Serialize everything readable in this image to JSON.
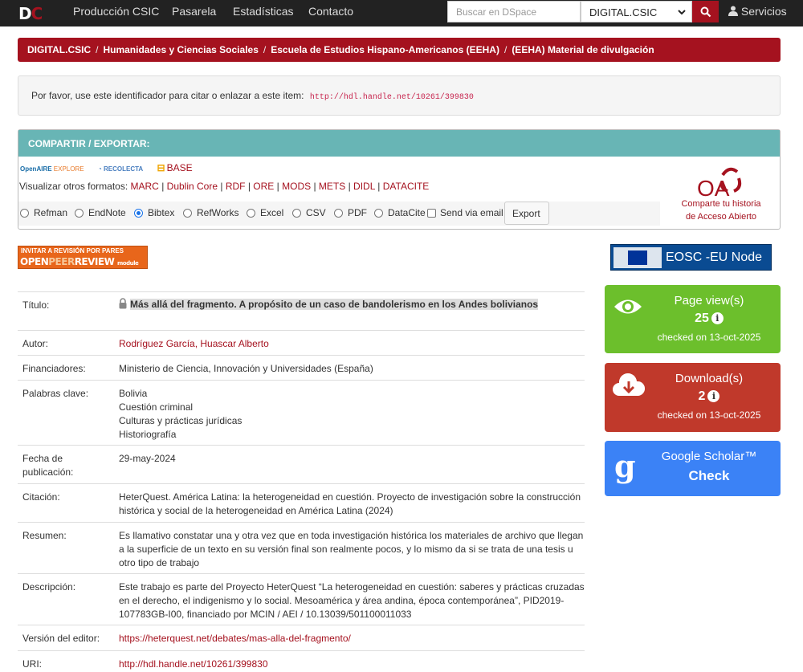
{
  "navbar": {
    "logo_d": "D",
    "logo_c": "C",
    "links": [
      "Producción CSIC",
      "Pasarela",
      "Estadísticas",
      "Contacto"
    ],
    "search_placeholder": "Buscar en DSpace",
    "scope": "DIGITAL.CSIC",
    "servicios": "Servicios"
  },
  "breadcrumb": [
    "DIGITAL.CSIC",
    "Humanidades y Ciencias Sociales",
    "Escuela de Estudios Hispano-Americanos (EEHA)",
    "(EEHA) Material de divulgación"
  ],
  "handle": {
    "text": "Por favor, use este identificador para citar o enlazar a este item:",
    "url": "http://hdl.handle.net/10261/399830"
  },
  "share": {
    "heading": "COMPARTIR / EXPORTAR:",
    "openaire": "OpenAIRE",
    "openaire_sub": "EXPLORE",
    "recolecta": "RECOLECTA",
    "base": "BASE",
    "formats_label": "Visualizar otros formatos:",
    "formats": [
      "MARC",
      "Dublin Core",
      "RDF",
      "ORE",
      "MODS",
      "METS",
      "DIDL",
      "DATACITE"
    ],
    "export_options": [
      "Refman",
      "EndNote",
      "Bibtex",
      "RefWorks",
      "Excel",
      "CSV",
      "PDF",
      "DataCite"
    ],
    "selected": "Bibtex",
    "send_email": "Send via email",
    "export_button": "Export",
    "oa_line1": "Comparte tu historia",
    "oa_line2": "de Acceso Abierto"
  },
  "opr": {
    "line1": "INVITAR A REVISIÓN POR PARES",
    "open": "OPEN",
    "peer": "PEER",
    "review": "REVIEW",
    "module": "module"
  },
  "eosc": "EOSC -EU Node",
  "metadata": {
    "titulo_label": "Título:",
    "titulo": "Más allá del fragmento. A propósito de un caso de bandolerismo en los Andes bolivianos",
    "autor_label": "Autor:",
    "autor": "Rodríguez García, Huascar Alberto",
    "financiadores_label": "Financiadores:",
    "financiadores": "Ministerio de Ciencia, Innovación y Universidades (España)",
    "palabras_label": "Palabras clave:",
    "palabras": [
      "Bolivia",
      "Cuestión criminal",
      "Culturas y prácticas jurídicas",
      "Historiografía"
    ],
    "fecha_label1": "Fecha de",
    "fecha_label2": "publicación:",
    "fecha": "29-may-2024",
    "citacion_label": "Citación:",
    "citacion": "HeterQuest. América Latina: la heterogeneidad en cuestión. Proyecto de investigación sobre la construcción histórica y social de la heterogeneidad en América Latina (2024)",
    "resumen_label": "Resumen:",
    "resumen": "Es llamativo constatar una y otra vez que en toda investigación histórica los materiales de archivo que llegan a la superficie de un texto en su versión final son realmente pocos, y lo mismo da si se trata de una tesis u otro tipo de trabajo",
    "descripcion_label": "Descripción:",
    "descripcion": "Este trabajo es parte del Proyecto HeterQuest “La heterogeneidad en cuestión: saberes y prácticas cruzadas en el derecho, el indigenismo y lo social. Mesoamérica y área andina, época contemporánea”, PID2019-107783GB-I00, financiado por MCIN / AEI / 10.13039/501100011033",
    "version_label": "Versión del editor:",
    "version": "https://heterquest.net/debates/mas-alla-del-fragmento/",
    "uri_label": "URI:",
    "uri": "http://hdl.handle.net/10261/399830"
  },
  "stats": {
    "views_title": "Page view(s)",
    "views": "25",
    "views_checked": "checked on 13-oct-2025",
    "downloads_title": "Download(s)",
    "downloads": "2",
    "downloads_checked": "checked on 13-oct-2025",
    "scholar_title": "Google Scholar™",
    "scholar_check": "Check",
    "info": "i"
  },
  "colors": {
    "brand": "#a5121f",
    "views": "#6cbf2c",
    "downloads": "#c0392b",
    "scholar": "#3b82f6",
    "share_head": "#68b5b5"
  }
}
